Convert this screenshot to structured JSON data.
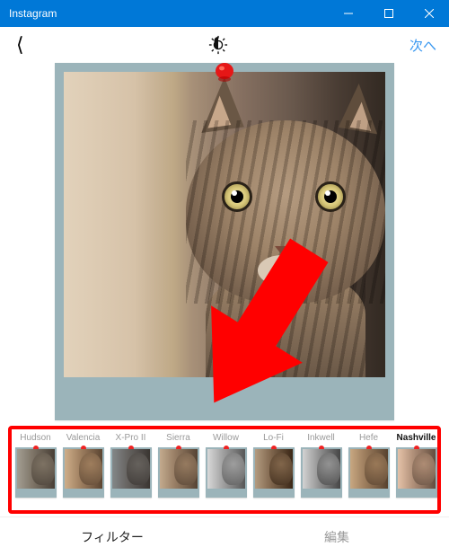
{
  "window": {
    "title": "Instagram"
  },
  "topbar": {
    "next_label": "次へ"
  },
  "filters": [
    {
      "name": "Hudson",
      "cls": "f-hudson",
      "active": false
    },
    {
      "name": "Valencia",
      "cls": "f-valencia",
      "active": false
    },
    {
      "name": "X-Pro II",
      "cls": "f-xpro",
      "active": false
    },
    {
      "name": "Sierra",
      "cls": "f-sierra",
      "active": false
    },
    {
      "name": "Willow",
      "cls": "f-willow",
      "active": false
    },
    {
      "name": "Lo-Fi",
      "cls": "f-lofi",
      "active": false
    },
    {
      "name": "Inkwell",
      "cls": "f-inkwell",
      "active": false
    },
    {
      "name": "Hefe",
      "cls": "f-hefe",
      "active": false
    },
    {
      "name": "Nashville",
      "cls": "f-nashville",
      "active": true
    }
  ],
  "tabs": {
    "filter_label": "フィルター",
    "edit_label": "編集",
    "active": "filter"
  },
  "annotation": {
    "highlight_color": "#ff0000"
  }
}
